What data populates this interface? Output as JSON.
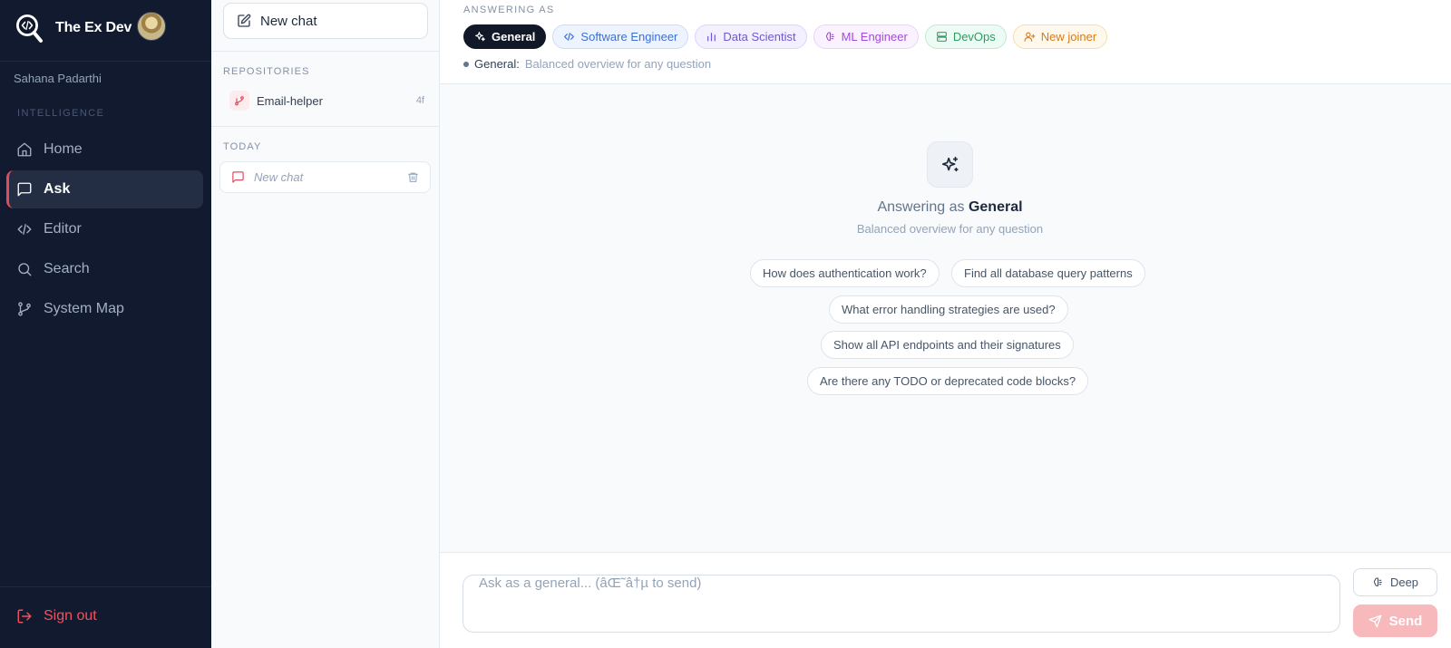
{
  "app": {
    "name": "The Ex Dev",
    "user_name": "Sahana Padarthi"
  },
  "sidebar": {
    "section_label": "INTELLIGENCE",
    "items": [
      {
        "label": "Home",
        "icon": "home-icon"
      },
      {
        "label": "Ask",
        "icon": "message-square-icon",
        "active": true
      },
      {
        "label": "Editor",
        "icon": "code-icon"
      },
      {
        "label": "Search",
        "icon": "search-icon"
      },
      {
        "label": "System Map",
        "icon": "git-branch-icon"
      }
    ],
    "sign_out": "Sign out"
  },
  "chat_panel": {
    "new_chat": "New chat",
    "repositories_label": "REPOSITORIES",
    "repositories": [
      {
        "name": "Email-helper",
        "count": "4f"
      }
    ],
    "today_label": "TODAY",
    "chats": [
      {
        "title": "New chat"
      }
    ]
  },
  "persona": {
    "label": "ANSWERING AS",
    "options": [
      {
        "label": "General",
        "icon": "sparkles-icon",
        "active": true,
        "color": "#111827"
      },
      {
        "label": "Software Engineer",
        "icon": "code-icon",
        "color": "#3b6fd6"
      },
      {
        "label": "Data Scientist",
        "icon": "bar-chart-icon",
        "color": "#7256d1"
      },
      {
        "label": "ML Engineer",
        "icon": "brain-icon",
        "color": "#a14bd8"
      },
      {
        "label": "DevOps",
        "icon": "server-icon",
        "color": "#2f9a63"
      },
      {
        "label": "New joiner",
        "icon": "user-plus-icon",
        "color": "#d47c1a"
      }
    ],
    "selected_name": "General:",
    "selected_desc": "Balanced overview for any question"
  },
  "empty_state": {
    "title_prefix": "Answering as",
    "title_persona": "General",
    "subtitle": "Balanced overview for any question",
    "suggestions": [
      "How does authentication work?",
      "Find all database query patterns",
      "What error handling strategies are used?",
      "Show all API endpoints and their signatures",
      "Are there any TODO or deprecated code blocks?"
    ]
  },
  "composer": {
    "placeholder": "Ask as a general... (âŒ˜â†µ to send)",
    "value": "",
    "deep_label": "Deep",
    "send_label": "Send"
  },
  "colors": {
    "accent": "#e04b5e",
    "sidebar_bg": "#111a2e",
    "send_bg": "#f8b9bd"
  }
}
